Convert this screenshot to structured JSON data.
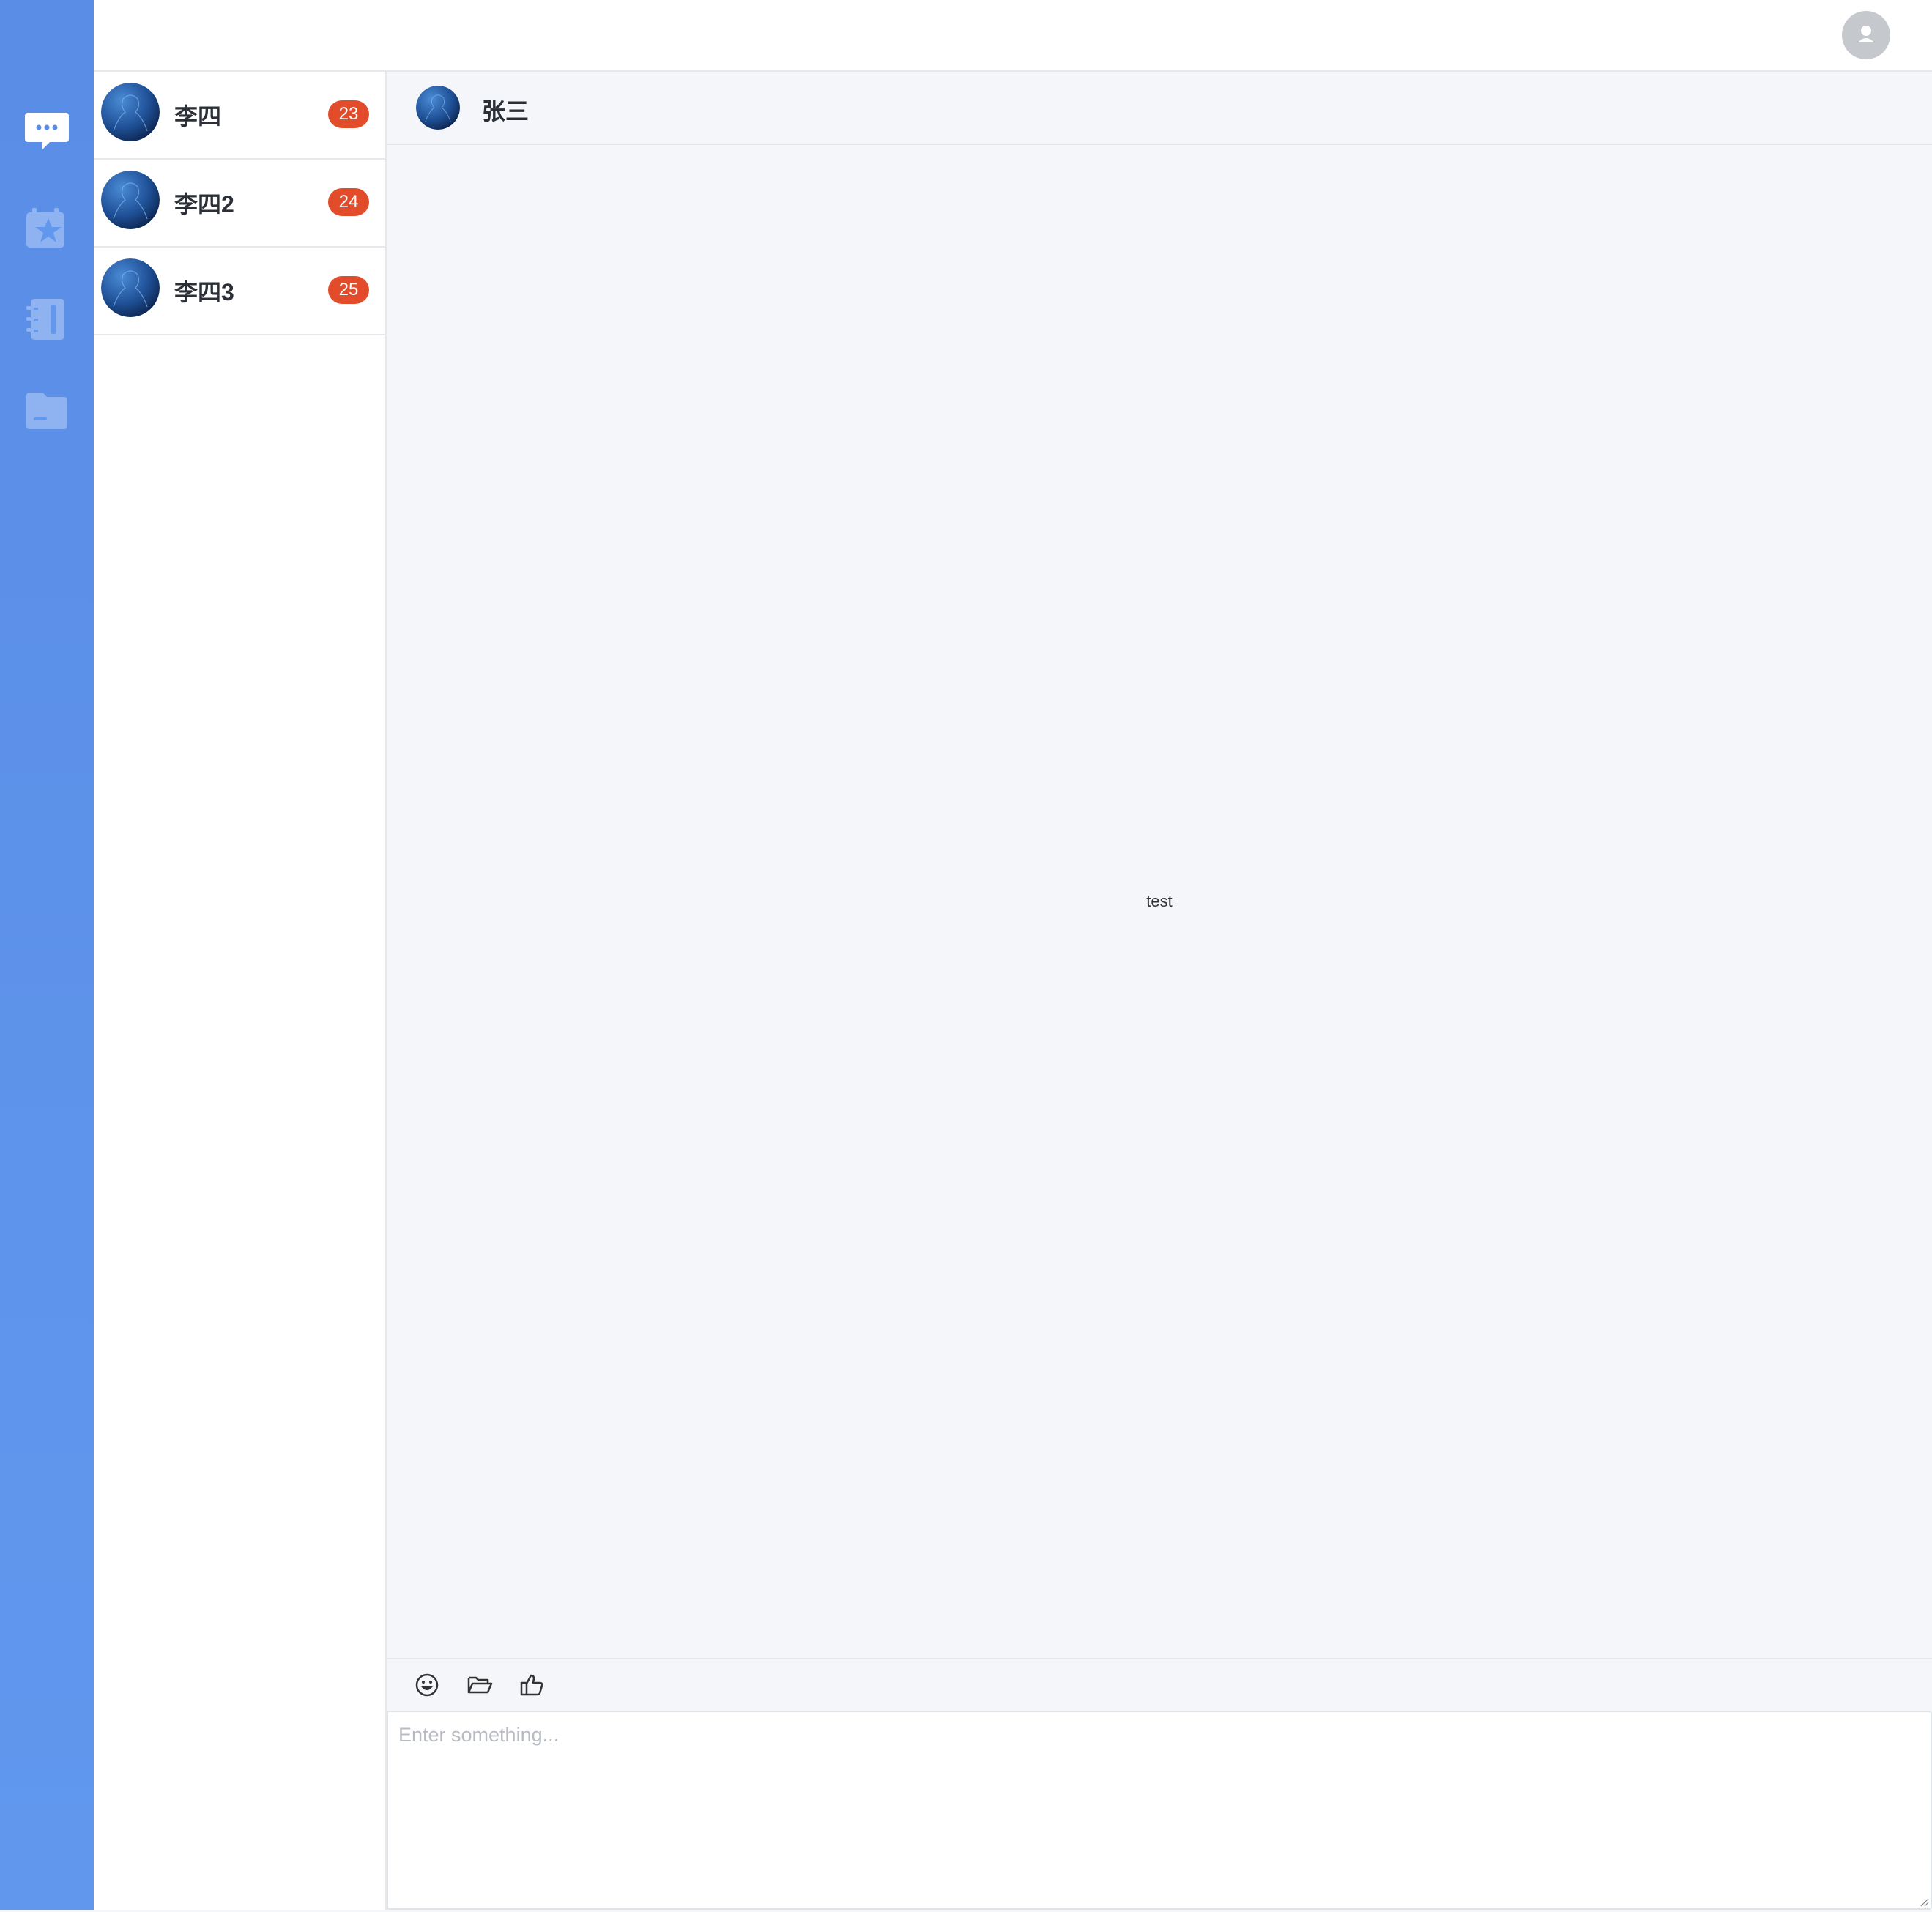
{
  "nav": {
    "items": [
      {
        "name": "chat",
        "icon": "chat-bubble-icon",
        "active": true
      },
      {
        "name": "tasks",
        "icon": "calendar-star-icon",
        "active": false
      },
      {
        "name": "contacts",
        "icon": "address-book-icon",
        "active": false
      },
      {
        "name": "files",
        "icon": "folder-icon",
        "active": false
      }
    ],
    "colors": {
      "top": "#5a8de6",
      "bottom": "#6198ee"
    }
  },
  "header": {
    "user_avatar_icon": "user-icon"
  },
  "conversations": [
    {
      "name": "李四",
      "unread": "23"
    },
    {
      "name": "李四2",
      "unread": "24"
    },
    {
      "name": "李四3",
      "unread": "25"
    }
  ],
  "chat": {
    "title": "张三",
    "messages": [
      {
        "text": "test"
      }
    ],
    "toolbar": [
      {
        "icon": "emoji-icon"
      },
      {
        "icon": "folder-open-icon"
      },
      {
        "icon": "thumbs-up-icon"
      }
    ],
    "input": {
      "value": "",
      "placeholder": "Enter something..."
    }
  },
  "colors": {
    "badge": "#e24c2a",
    "accent": "#5a8de6"
  }
}
